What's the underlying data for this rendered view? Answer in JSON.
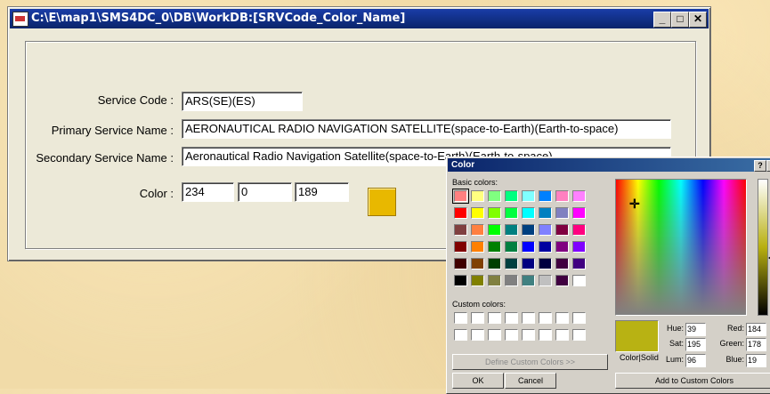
{
  "main_window": {
    "title": "C:\\E\\map1\\SMS4DC_0\\DB\\WorkDB:[SRVCode_Color_Name]",
    "buttons": {
      "minimize": "_",
      "maximize": "□",
      "close": "✕"
    },
    "fields": {
      "service_code_label": "Service Code :",
      "service_code_value": "ARS(SE)(ES)",
      "primary_label": "Primary Service Name :",
      "primary_value": "AERONAUTICAL RADIO NAVIGATION SATELLITE(space-to-Earth)(Earth-to-space)",
      "secondary_label": "Secondary Service Name :",
      "secondary_value": "Aeronautical Radio Navigation Satellite(space-to-Earth)(Earth-to-space)",
      "color_label": "Color :",
      "color_r": "234",
      "color_g": "0",
      "color_b": "189"
    }
  },
  "color_dialog": {
    "title": "Color",
    "help_btn": "?",
    "close_btn": "✕",
    "basic_label": "Basic colors:",
    "basic_colors": [
      "#ff8080",
      "#ffff80",
      "#80ff80",
      "#00ff80",
      "#80ffff",
      "#0080ff",
      "#ff80c0",
      "#ff80ff",
      "#ff0000",
      "#ffff00",
      "#80ff00",
      "#00ff40",
      "#00ffff",
      "#0080c0",
      "#8080c0",
      "#ff00ff",
      "#804040",
      "#ff8040",
      "#00ff00",
      "#008080",
      "#004080",
      "#8080ff",
      "#800040",
      "#ff0080",
      "#800000",
      "#ff8000",
      "#008000",
      "#008040",
      "#0000ff",
      "#0000a0",
      "#800080",
      "#8000ff",
      "#400000",
      "#804000",
      "#004000",
      "#004040",
      "#000080",
      "#000040",
      "#400040",
      "#400080",
      "#000000",
      "#808000",
      "#808040",
      "#808080",
      "#408080",
      "#c0c0c0",
      "#400040",
      "#ffffff"
    ],
    "custom_label": "Custom colors:",
    "define_custom": "Define Custom Colors >>",
    "ok": "OK",
    "cancel": "Cancel",
    "color_solid": "Color|Solid",
    "hue_label": "Hue:",
    "hue": "39",
    "sat_label": "Sat:",
    "sat": "195",
    "lum_label": "Lum:",
    "lum": "96",
    "red_label": "Red:",
    "red": "184",
    "green_label": "Green:",
    "green": "178",
    "blue_label": "Blue:",
    "blue": "19",
    "add_custom": "Add to Custom Colors"
  }
}
